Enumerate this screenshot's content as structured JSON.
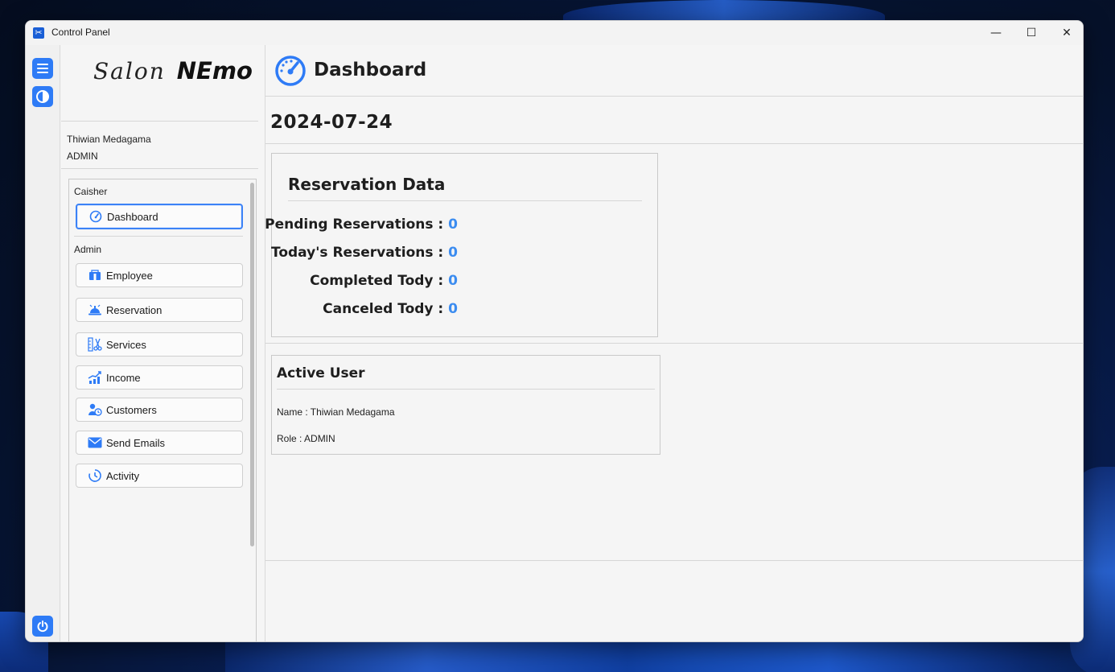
{
  "window": {
    "title": "Control Panel",
    "minimize": "—",
    "maximize": "☐",
    "close": "✕"
  },
  "brand": {
    "script": "Salon",
    "bold": "NEmo"
  },
  "user": {
    "name": "Thiwian Medagama",
    "role": "ADMIN"
  },
  "menu": {
    "cashier_label": "Caisher",
    "admin_label": "Admin",
    "dashboard": "Dashboard",
    "items": [
      {
        "label": "Employee",
        "icon": "employee-icon"
      },
      {
        "label": "Reservation",
        "icon": "reception-bell-icon"
      },
      {
        "label": "Services",
        "icon": "scissors-icon"
      },
      {
        "label": "Income",
        "icon": "income-chart-icon"
      },
      {
        "label": "Customers",
        "icon": "customers-icon"
      },
      {
        "label": "Send Emails",
        "icon": "envelope-icon"
      },
      {
        "label": "Activity",
        "icon": "clock-icon"
      }
    ]
  },
  "page": {
    "title": "Dashboard",
    "date": "2024-07-24"
  },
  "reservation_card": {
    "title": "Reservation Data",
    "rows": [
      {
        "label": "Pending Reservations : ",
        "value": "0"
      },
      {
        "label": "Today's Reservations : ",
        "value": "0"
      },
      {
        "label": "Completed Tody : ",
        "value": "0"
      },
      {
        "label": "Canceled Tody : ",
        "value": "0"
      }
    ]
  },
  "active_user_card": {
    "title": "Active User",
    "name_line": "Name : Thiwian Medagama",
    "role_line": "Role : ADMIN"
  },
  "colors": {
    "accent": "#2e7bf6",
    "stat_value": "#3b8cf0"
  }
}
